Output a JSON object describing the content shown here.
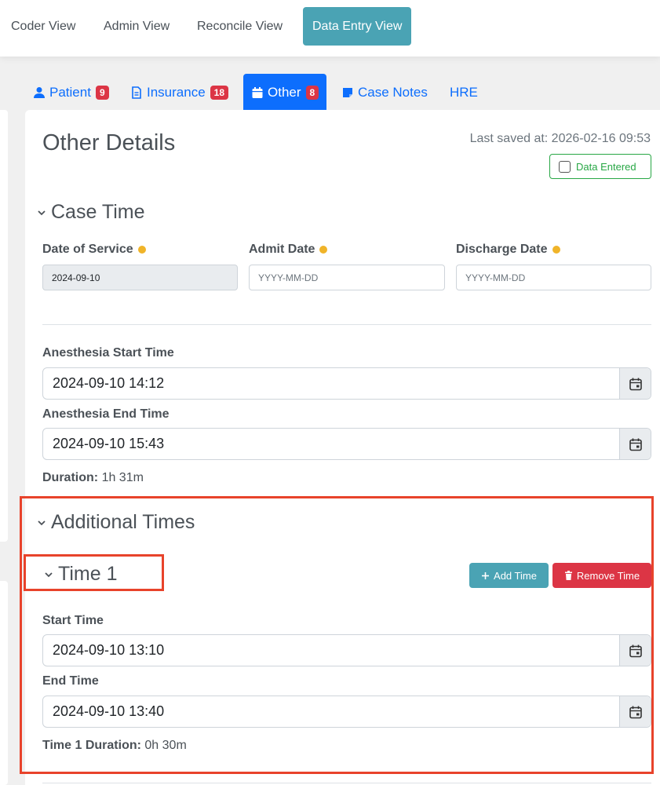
{
  "views": {
    "coder": "Coder View",
    "admin": "Admin View",
    "reconcile": "Reconcile View",
    "data_entry": "Data Entry View"
  },
  "tabs": {
    "patient": {
      "label": "Patient",
      "badge": "9"
    },
    "insurance": {
      "label": "Insurance",
      "badge": "18"
    },
    "other": {
      "label": "Other",
      "badge": "8"
    },
    "case_notes": {
      "label": "Case Notes"
    },
    "hre": {
      "label": "HRE"
    }
  },
  "page": {
    "title": "Other Details",
    "last_saved": "Last saved at: 2026-02-16 09:53",
    "data_entered_label": "Data Entered"
  },
  "case_time": {
    "title": "Case Time",
    "date_of_service_label": "Date of Service",
    "date_of_service_value": "2024-09-10",
    "admit_date_label": "Admit Date",
    "admit_date_placeholder": "YYYY-MM-DD",
    "discharge_date_label": "Discharge Date",
    "discharge_date_placeholder": "YYYY-MM-DD",
    "anesthesia_start_label": "Anesthesia Start Time",
    "anesthesia_start_value": "2024-09-10 14:12",
    "anesthesia_end_label": "Anesthesia End Time",
    "anesthesia_end_value": "2024-09-10 15:43",
    "duration_label": "Duration:",
    "duration_value": "1h 31m"
  },
  "additional_times": {
    "title": "Additional Times",
    "time1": {
      "title": "Time 1",
      "add_label": "Add Time",
      "remove_label": "Remove Time",
      "start_label": "Start Time",
      "start_value": "2024-09-10 13:10",
      "end_label": "End Time",
      "end_value": "2024-09-10 13:40",
      "duration_label": "Time 1 Duration:",
      "duration_value": "0h 30m"
    }
  },
  "colors": {
    "accent_teal": "#4aa3b4",
    "primary_blue": "#0d6efd",
    "danger_red": "#dc3545",
    "success_green": "#28a745",
    "required_dot": "#f0b429",
    "highlight_box": "#e8432b"
  },
  "icons": {
    "patient": "user-icon",
    "insurance": "document-icon",
    "other": "calendar-icon",
    "case_notes": "note-icon",
    "chevron": "chevron-down-icon",
    "calendar_picker": "calendar-icon",
    "add": "plus-icon",
    "remove": "trash-icon"
  }
}
